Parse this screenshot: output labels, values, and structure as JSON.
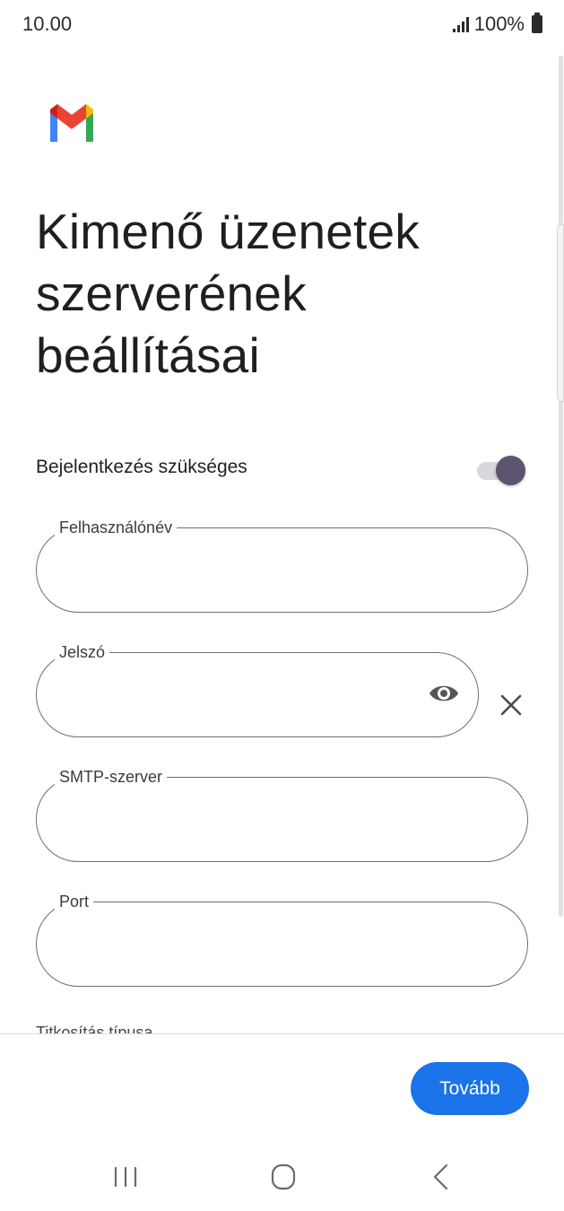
{
  "status_bar": {
    "time": "10.00",
    "battery": "100%"
  },
  "app": {
    "logo_icon": "gmail-logo-icon",
    "colors": {
      "red": "#ea4335",
      "blue": "#4285f4",
      "green": "#34a853",
      "yellow": "#fbbc04",
      "accent": "#1a73e8",
      "toggle_thumb": "#5d5570"
    }
  },
  "page": {
    "title": "Kimenő üzenetek szerverének beállításai"
  },
  "toggle": {
    "label": "Bejelentkezés szükséges",
    "checked": true
  },
  "fields": {
    "username": {
      "label": "Felhasználónév",
      "value": ""
    },
    "password": {
      "label": "Jelszó",
      "value": "",
      "show_password_icon": "eye-icon",
      "clear_icon": "close-icon"
    },
    "smtp_server": {
      "label": "SMTP-szerver",
      "value": ""
    },
    "port": {
      "label": "Port",
      "value": ""
    }
  },
  "encryption": {
    "label": "Titkosítás típusa"
  },
  "footer": {
    "next_label": "Tovább"
  },
  "nav": {
    "recents_icon": "recents-icon",
    "home_icon": "home-icon",
    "back_icon": "back-icon"
  }
}
